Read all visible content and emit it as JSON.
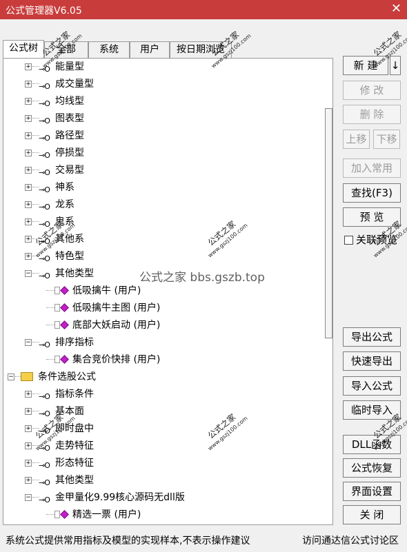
{
  "window": {
    "title": "公式管理器V6.05"
  },
  "tabs": [
    {
      "label": "公式树"
    },
    {
      "label": "全部"
    },
    {
      "label": "系统"
    },
    {
      "label": "用户"
    },
    {
      "label": "按日期浏览"
    }
  ],
  "tree": {
    "rows": [
      {
        "label": "能量型"
      },
      {
        "label": "成交量型"
      },
      {
        "label": "均线型"
      },
      {
        "label": "图表型"
      },
      {
        "label": "路径型"
      },
      {
        "label": "停损型"
      },
      {
        "label": "交易型"
      },
      {
        "label": "神系"
      },
      {
        "label": "龙系"
      },
      {
        "label": "鬼系"
      },
      {
        "label": "其他系"
      },
      {
        "label": "特色型"
      },
      {
        "label": "其他类型"
      },
      {
        "label": "低吸擒牛 (用户)"
      },
      {
        "label": "低吸擒牛主图 (用户)"
      },
      {
        "label": "底部大妖启动 (用户)"
      },
      {
        "label": "排序指标"
      },
      {
        "label": "集合竞价快排 (用户)"
      },
      {
        "label": "条件选股公式"
      },
      {
        "label": "指标条件"
      },
      {
        "label": "基本面"
      },
      {
        "label": "即时盘中"
      },
      {
        "label": "走势特征"
      },
      {
        "label": "形态特征"
      },
      {
        "label": "其他类型"
      },
      {
        "label": "金甲量化9.99核心源码无dll版"
      },
      {
        "label": "精选一票 (用户)"
      }
    ]
  },
  "buttons": {
    "new": "新 建",
    "new_arrow": "↓",
    "modify": "修 改",
    "delete": "删 除",
    "move_up": "上移",
    "move_down": "下移",
    "add_common": "加入常用",
    "find": "查找(F3)",
    "preview": "预 览",
    "link_preview": "关联预览",
    "export": "导出公式",
    "quick_export": "快速导出",
    "import": "导入公式",
    "temp_import": "临时导入",
    "dll": "DLL函数",
    "restore": "公式恢复",
    "ui_settings": "界面设置",
    "close": "关 闭"
  },
  "status": {
    "left": "系统公式提供常用指标及模型的实现样本,不表示操作建议",
    "right": "访问通达信公式讨论区"
  },
  "watermark": {
    "center": "公式之家 bbs.gszb.top",
    "stamp": "公式之家",
    "stamp_url": "www.gszj100.com"
  },
  "colors": {
    "titlebar": "#c93c3c",
    "gem": "#c21fc9",
    "folder": "#f4cf4a"
  }
}
